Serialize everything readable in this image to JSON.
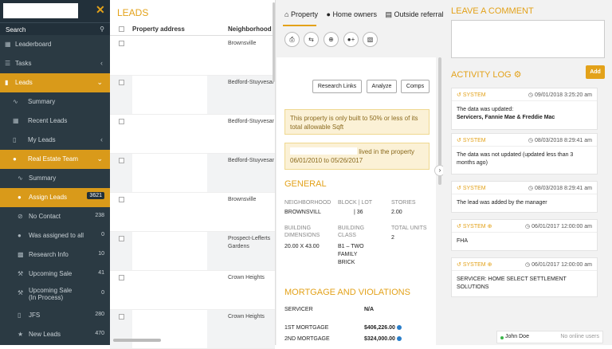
{
  "sidebar": {
    "search_label": "Search",
    "items": [
      {
        "label": "Leaderboard"
      },
      {
        "label": "Tasks"
      },
      {
        "label": "Leads"
      },
      {
        "label": "Summary"
      },
      {
        "label": "Recent Leads"
      },
      {
        "label": "My Leads"
      },
      {
        "label": "Real Estate Team"
      },
      {
        "label": "Summary"
      },
      {
        "label": "Assign Leads",
        "count": "3621"
      },
      {
        "label": "No Contact",
        "count": "238"
      },
      {
        "label": "Was assigned to all",
        "count": "0"
      },
      {
        "label": "Research Info",
        "count": "10"
      },
      {
        "label": "Upcoming Sale",
        "count": "41"
      },
      {
        "label": "Upcoming Sale",
        "label2": "(In Process)",
        "count": "0"
      },
      {
        "label": "JFS",
        "count": "280"
      },
      {
        "label": "New Leads",
        "count": "470"
      }
    ]
  },
  "leads": {
    "title": "LEADS",
    "col_address": "Property address",
    "col_neighborhood": "Neighborhood",
    "rows": [
      {
        "neighborhood": "Brownsville"
      },
      {
        "neighborhood": "Bedford-Stuyvesant"
      },
      {
        "neighborhood": "Bedford-Stuyvesant"
      },
      {
        "neighborhood": "Bedford-Stuyvesant"
      },
      {
        "neighborhood": "Brownsville"
      },
      {
        "neighborhood": "Prospect-Lefferts Gardens"
      },
      {
        "neighborhood": "Crown Heights"
      },
      {
        "neighborhood": "Crown Heights"
      }
    ]
  },
  "detail": {
    "tabs": [
      "Property",
      "Home owners",
      "Outside referral"
    ],
    "tool_icons": [
      "print-icon",
      "retweet-icon",
      "plus-circle-icon",
      "add-user-icon",
      "trash-icon"
    ],
    "buttons": {
      "research": "Research Links",
      "analyze": "Analyze",
      "comps": "Comps"
    },
    "warning": "This property is only built to 50% or less of its total allowable Sqft",
    "lived_text": "lived in the property",
    "lived_dates": "06/01/2010 to 05/26/2017",
    "general_title": "GENERAL",
    "general": {
      "neighborhood_label": "NEIGHBORHOOD",
      "neighborhood_value": "BROWNSVILL",
      "block_lot_label": "BLOCK | LOT",
      "block_lot_value": "| 36",
      "stories_label": "STORIES",
      "stories_value": "2.00",
      "dimensions_label": "BUILDING DIMENSIONS",
      "dimensions_value": "20.00 X 43.00",
      "class_label": "BUILDING CLASS",
      "class_value": "B1 – TWO FAMILY BRICK",
      "units_label": "TOTAL UNITS",
      "units_value": "2"
    },
    "mortgage_title": "MORTGAGE AND VIOLATIONS",
    "servicer_label": "SERVICER",
    "servicer_value": "N/A",
    "m1_label": "1ST MORTGAGE",
    "m1_value": "$406,226.00",
    "m2_label": "2ND MORTGAGE",
    "m2_value": "$324,000.00"
  },
  "right": {
    "comment_title": "LEAVE A COMMENT",
    "activity_title": "ACTIVITY LOG",
    "add_label": "Add",
    "logs": [
      {
        "source": "SYSTEM",
        "date": "09/01/2018 3:25:20 am",
        "text1": "The data was updated:",
        "text2": "Servicers, Fannie Mae & Freddie Mac"
      },
      {
        "source": "SYSTEM",
        "date": "08/03/2018 8:29:41 am",
        "text1": "The data was not updated (updated less than 3 months ago)",
        "text2": ""
      },
      {
        "source": "SYSTEM",
        "date": "08/03/2018 8:29:41 am",
        "text1": "The lead was added by the manager",
        "text2": ""
      },
      {
        "source": "SYSTEM",
        "date": "06/01/2017 12:00:00 am",
        "text1": "FHA",
        "text2": ""
      },
      {
        "source": "SYSTEM",
        "date": "06/01/2017 12:00:00 am",
        "text1": "SERVICER: HOME SELECT SETTLEMENT SOLUTIONS",
        "text2": ""
      }
    ],
    "online_user": "John Doe",
    "no_online": "No online users"
  }
}
